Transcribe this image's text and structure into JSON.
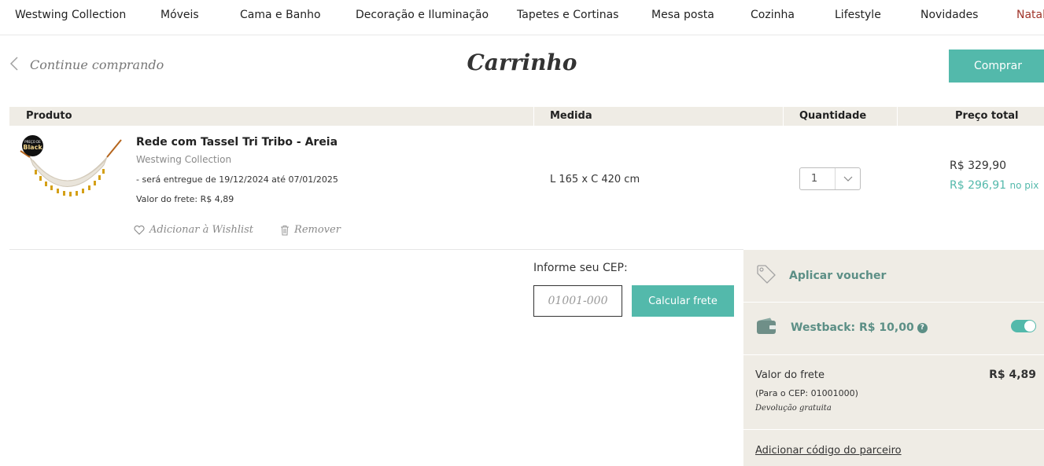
{
  "nav": {
    "items": [
      {
        "label": "Westwing Collection"
      },
      {
        "label": "Móveis"
      },
      {
        "label": "Cama e Banho"
      },
      {
        "label": "Decoração e Iluminação"
      },
      {
        "label": "Tapetes e Cortinas"
      },
      {
        "label": "Mesa posta"
      },
      {
        "label": "Cozinha"
      },
      {
        "label": "Lifestyle"
      },
      {
        "label": "Novidades"
      },
      {
        "label": "Natal"
      }
    ],
    "accent_color": "#a0352b"
  },
  "header": {
    "back_label": "Continue comprando",
    "title": "Carrinho",
    "buy_label": "Comprar"
  },
  "table": {
    "columns": [
      "Produto",
      "Medida",
      "Quantidade",
      "Preço total"
    ]
  },
  "product": {
    "name": "Rede com Tassel Tri Tribo - Areia",
    "brand": "Westwing Collection",
    "badge_top": "PREÇO DE",
    "badge_bottom": "Black",
    "delivery": "- será entregue de 19/12/2024 até 07/01/2025",
    "freight": "Valor do frete: R$ 4,89",
    "wishlist_label": "Adicionar à Wishlist",
    "remove_label": "Remover",
    "size": "L 165 x C 420 cm",
    "quantity": "1",
    "price": "R$ 329,90",
    "price_pix": "R$ 296,91",
    "price_pix_suffix": "no pix"
  },
  "cep": {
    "label": "Informe seu CEP:",
    "placeholder": "01001-000",
    "button_label": "Calcular frete"
  },
  "summary": {
    "voucher_label": "Aplicar voucher",
    "westback_label": "Westback: R$ 10,00",
    "westback_enabled": true,
    "freight_label": "Valor do frete",
    "freight_value": "R$ 4,89",
    "freight_cep": "(Para o CEP: 01001000)",
    "return_note": "Devolução gratuita",
    "partner_label": "Adicionar código do parceiro"
  },
  "colors": {
    "primary": "#53b9ab",
    "muted_green": "#5c8f86",
    "panel_bg": "#efece5"
  },
  "icons": {
    "back": "chevron-left-icon",
    "wishlist": "heart-icon",
    "remove": "trash-icon",
    "quantity": "chevron-down-icon",
    "voucher": "tag-icon",
    "westback": "wallet-icon",
    "help": "question-circle-icon"
  }
}
